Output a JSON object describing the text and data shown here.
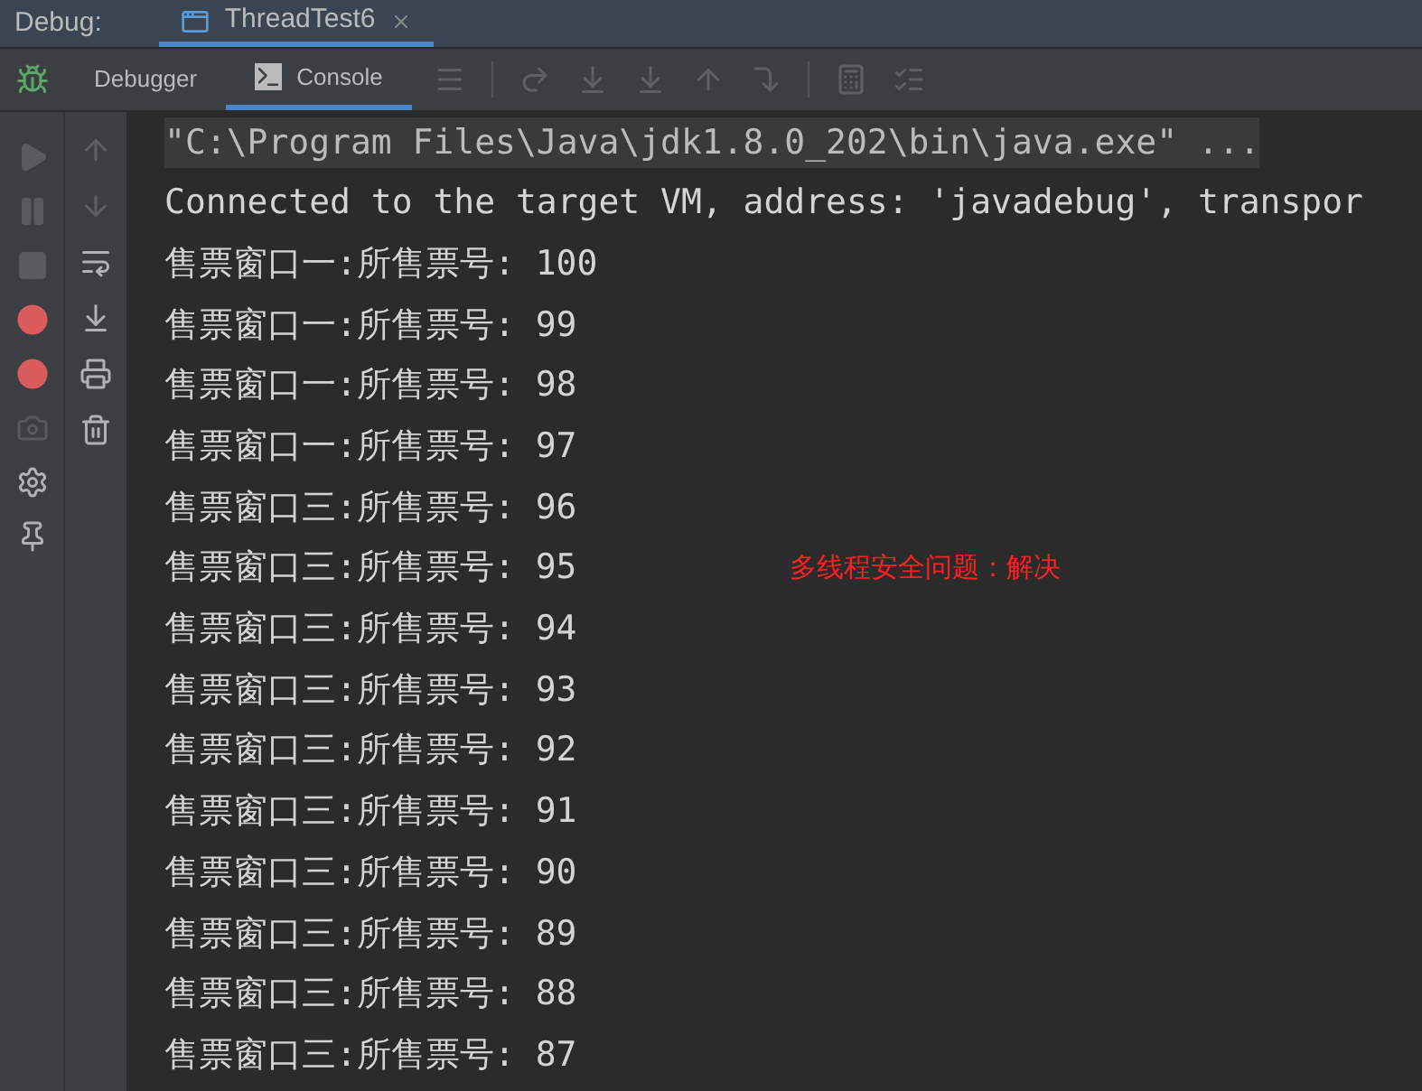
{
  "debug_bar": {
    "label": "Debug:",
    "tabs": [
      {
        "label": "ThreadTest6",
        "selected": true
      }
    ]
  },
  "tool_tabs": [
    {
      "label": "Debugger",
      "selected": false,
      "kind": "debugger"
    },
    {
      "label": "Console",
      "selected": true,
      "kind": "console"
    }
  ],
  "side_toolbar": [
    {
      "kind": "resume",
      "disabled": true
    },
    {
      "kind": "pause",
      "disabled": true
    },
    {
      "kind": "stop",
      "disabled": true
    },
    {
      "kind": "breakpoints",
      "disabled": false
    },
    {
      "kind": "mute",
      "disabled": false
    },
    {
      "kind": "camera",
      "disabled": true
    },
    {
      "kind": "settings",
      "disabled": false
    },
    {
      "kind": "pin",
      "disabled": false
    }
  ],
  "console": {
    "lines": [
      {
        "text": "\"C:\\Program Files\\Java\\jdk1.8.0_202\\bin\\java.exe\" ...",
        "kind": "command"
      },
      {
        "text": "Connected to the target VM, address: 'javadebug', transpor",
        "kind": "output"
      },
      {
        "text": "售票窗口一:所售票号: 100",
        "kind": "output"
      },
      {
        "text": "售票窗口一:所售票号: 99",
        "kind": "output"
      },
      {
        "text": "售票窗口一:所售票号: 98",
        "kind": "output"
      },
      {
        "text": "售票窗口一:所售票号: 97",
        "kind": "output"
      },
      {
        "text": "售票窗口三:所售票号: 96",
        "kind": "output"
      },
      {
        "text": "售票窗口三:所售票号: 95",
        "kind": "output"
      },
      {
        "text": "售票窗口三:所售票号: 94",
        "kind": "output"
      },
      {
        "text": "售票窗口三:所售票号: 93",
        "kind": "output"
      },
      {
        "text": "售票窗口三:所售票号: 92",
        "kind": "output"
      },
      {
        "text": "售票窗口三:所售票号: 91",
        "kind": "output"
      },
      {
        "text": "售票窗口三:所售票号: 90",
        "kind": "output"
      },
      {
        "text": "售票窗口三:所售票号: 89",
        "kind": "output"
      },
      {
        "text": "售票窗口三:所售票号: 88",
        "kind": "output"
      },
      {
        "text": "售票窗口三:所售票号: 87",
        "kind": "output"
      }
    ],
    "annotation": "多线程安全问题：解决"
  }
}
